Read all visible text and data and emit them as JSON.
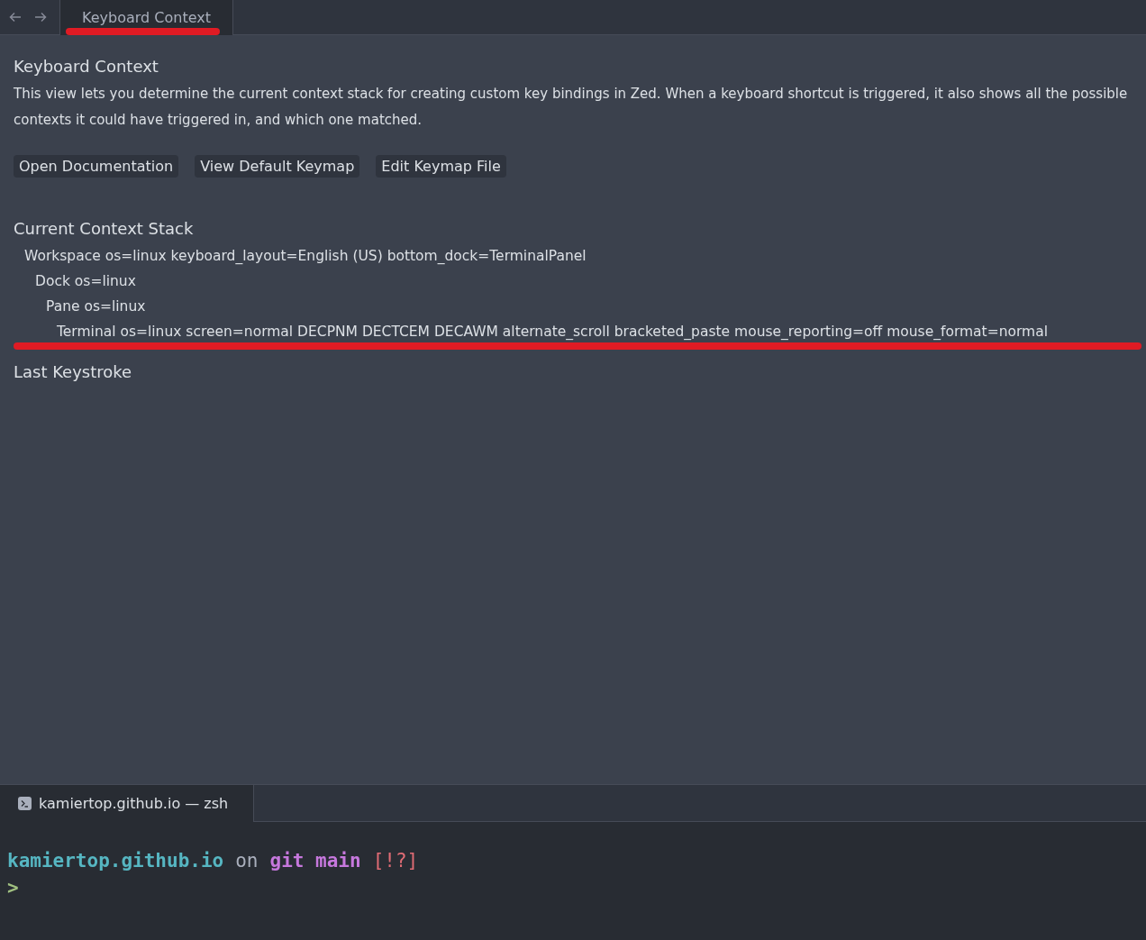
{
  "tab_bar": {
    "tabs": [
      {
        "label": "Keyboard Context",
        "selected": true,
        "underlined": true
      }
    ]
  },
  "view": {
    "title": "Keyboard Context",
    "description": "This view lets you determine the current context stack for creating custom key bindings in Zed. When a keyboard shortcut is triggered, it also shows all the possible contexts it could have triggered in, and which one matched.",
    "buttons": [
      "Open Documentation",
      "View Default Keymap",
      "Edit Keymap File"
    ],
    "stack_heading": "Current Context Stack",
    "stack": [
      {
        "text": "Workspace os=linux keyboard_layout=English (US) bottom_dock=TerminalPanel",
        "underlined": false,
        "children": [
          {
            "text": "Dock os=linux",
            "underlined": false,
            "children": [
              {
                "text": "Pane os=linux",
                "underlined": false,
                "children": [
                  {
                    "text": "Terminal os=linux screen=normal DECPNM DECTCEM DECAWM alternate_scroll bracketed_paste mouse_reporting=off mouse_format=normal",
                    "underlined": true
                  }
                ]
              }
            ]
          }
        ]
      }
    ],
    "keystroke_heading": "Last Keystroke"
  },
  "terminal": {
    "tab": {
      "label": "kamiertop.github.io — zsh",
      "selected": true
    },
    "prompt": [
      {
        "text": "kamiertop.github.io",
        "color": "#56b6c2",
        "bold": true
      },
      {
        "text": "on",
        "color": "#a9afbc",
        "bold": false
      },
      {
        "text": "git main",
        "color": "#c678dd",
        "bold": true
      },
      {
        "text": "[!?]",
        "color": "#e06c75",
        "bold": false
      }
    ],
    "input_prompt": ">"
  }
}
